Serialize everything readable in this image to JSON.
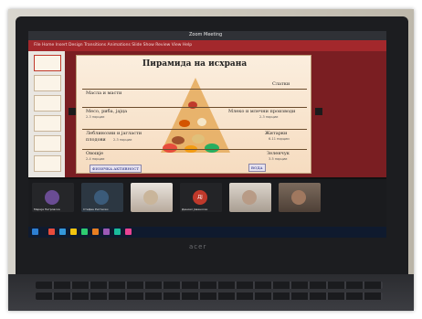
{
  "window": {
    "title": "Zoom Meeting"
  },
  "ppt": {
    "ribbon": "File   Home   Insert   Design   Transitions   Animations   Slide Show   Review   View   Help"
  },
  "slide": {
    "title": "Пирамида на исхрана",
    "levels": [
      {
        "left": "Масла и масти",
        "right": "Слатки"
      },
      {
        "left": "Месо, риба, јајца",
        "left_sub": "2-3 порции",
        "right": "Млеко и млечни производи",
        "right_sub": "2-3 порции"
      },
      {
        "left": "Леблинозни и јагласти",
        "left2": "плодови",
        "left_sub": "2-3 порции",
        "right": "Житарки",
        "right_sub": "6-11 порции"
      },
      {
        "left": "Овошје",
        "left_sub": "2-4 порции",
        "right": "Зеленчук",
        "right_sub": "3-5 порции"
      }
    ],
    "bottom_left_tag": "ФИЗИЧКА АКТИВНОСТ",
    "bottom_right_tag": "ВОДА"
  },
  "participants": [
    {
      "name": "Марија Петровска",
      "initials": "",
      "color": "#6a4c93"
    },
    {
      "name": "Стефан Ристески",
      "initials": "",
      "color": "#3b5b7a"
    },
    {
      "name": "",
      "initials": "",
      "color": "#8c7a6b"
    },
    {
      "name": "Даниел Јованоски",
      "initials": "ДЈ",
      "color": "#c0392b"
    },
    {
      "name": "",
      "initials": "",
      "color": "#9a8f85"
    },
    {
      "name": "",
      "initials": "",
      "color": "#7b5a4a"
    }
  ],
  "taskbar": {
    "clock": "",
    "icon_colors": [
      "#e74c3c",
      "#3498db",
      "#f1c40f",
      "#2ecc71",
      "#e67e22",
      "#9b59b6",
      "#1abc9c",
      "#e84393"
    ]
  },
  "laptop": {
    "brand": "acer"
  }
}
